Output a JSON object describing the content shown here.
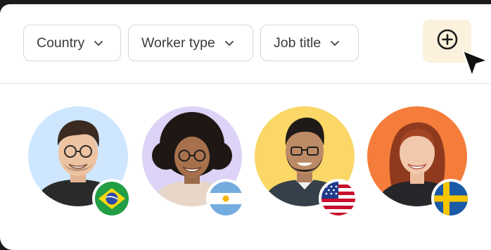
{
  "filters": [
    {
      "label": "Country"
    },
    {
      "label": "Worker type"
    },
    {
      "label": "Job title"
    }
  ],
  "colors": {
    "add_button_bg": "#fbf1dc",
    "avatar_bg_1": "#cfe6ff",
    "avatar_bg_2": "#ddd3f6",
    "avatar_bg_3": "#fad766",
    "avatar_bg_4": "#f57d3b"
  },
  "icons": {
    "filter_chevron": "chevron-down-icon",
    "add": "plus-circle-icon",
    "pointer": "cursor-arrow-icon"
  },
  "workers": [
    {
      "country_flag": "brazil"
    },
    {
      "country_flag": "argentina"
    },
    {
      "country_flag": "united-states"
    },
    {
      "country_flag": "sweden"
    }
  ]
}
